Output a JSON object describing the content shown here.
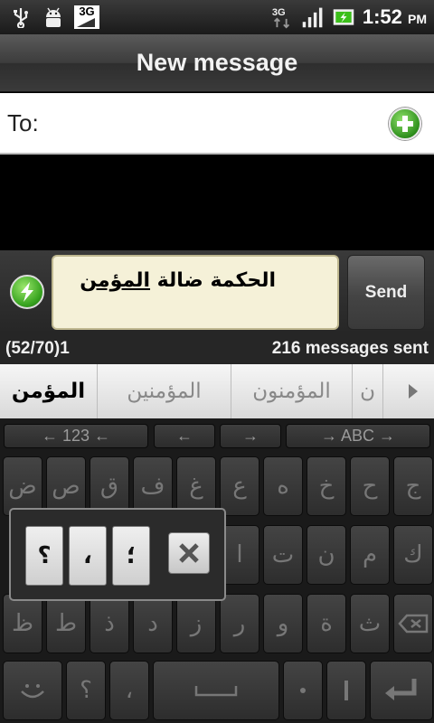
{
  "status_bar": {
    "left_icons": [
      "usb-icon",
      "android-debug-icon",
      "3g-data-icon"
    ],
    "network_label": "3G",
    "data_label": "3G",
    "time": "1:52",
    "ampm": "PM",
    "battery_color": "#3bbf1a"
  },
  "title": "New message",
  "recipient": {
    "label": "To:",
    "value": ""
  },
  "compose": {
    "text_plain": "الحكمة ضالة ",
    "text_underlined": "المؤمن",
    "send_label": "Send"
  },
  "counter": {
    "left": "(52/70)1",
    "right": "216 messages sent"
  },
  "suggestions": [
    "المؤمن",
    "المؤمنين",
    "المؤمنون",
    "ن"
  ],
  "keyboard": {
    "nav": [
      "← 123 ←",
      "←",
      "→",
      "→ ABC →"
    ],
    "rows": [
      [
        "ض",
        "ص",
        "ق",
        "ف",
        "غ",
        "ع",
        "ه",
        "خ",
        "ح",
        "ج"
      ],
      [
        "",
        "",
        "",
        "",
        "",
        "ا",
        "ت",
        "ن",
        "م",
        "ك"
      ],
      [
        "ظ",
        "ط",
        "ذ",
        "د",
        "ز",
        "ر",
        "و",
        "ة",
        "ث",
        ""
      ],
      [
        "",
        "؟",
        "،",
        "",
        "",
        "",
        "",
        "",
        "",
        ""
      ]
    ],
    "popup": [
      "؟",
      "،",
      "؛"
    ]
  },
  "colors": {
    "accent_green": "#2e8f1c",
    "paper": "#f5f1d8"
  }
}
